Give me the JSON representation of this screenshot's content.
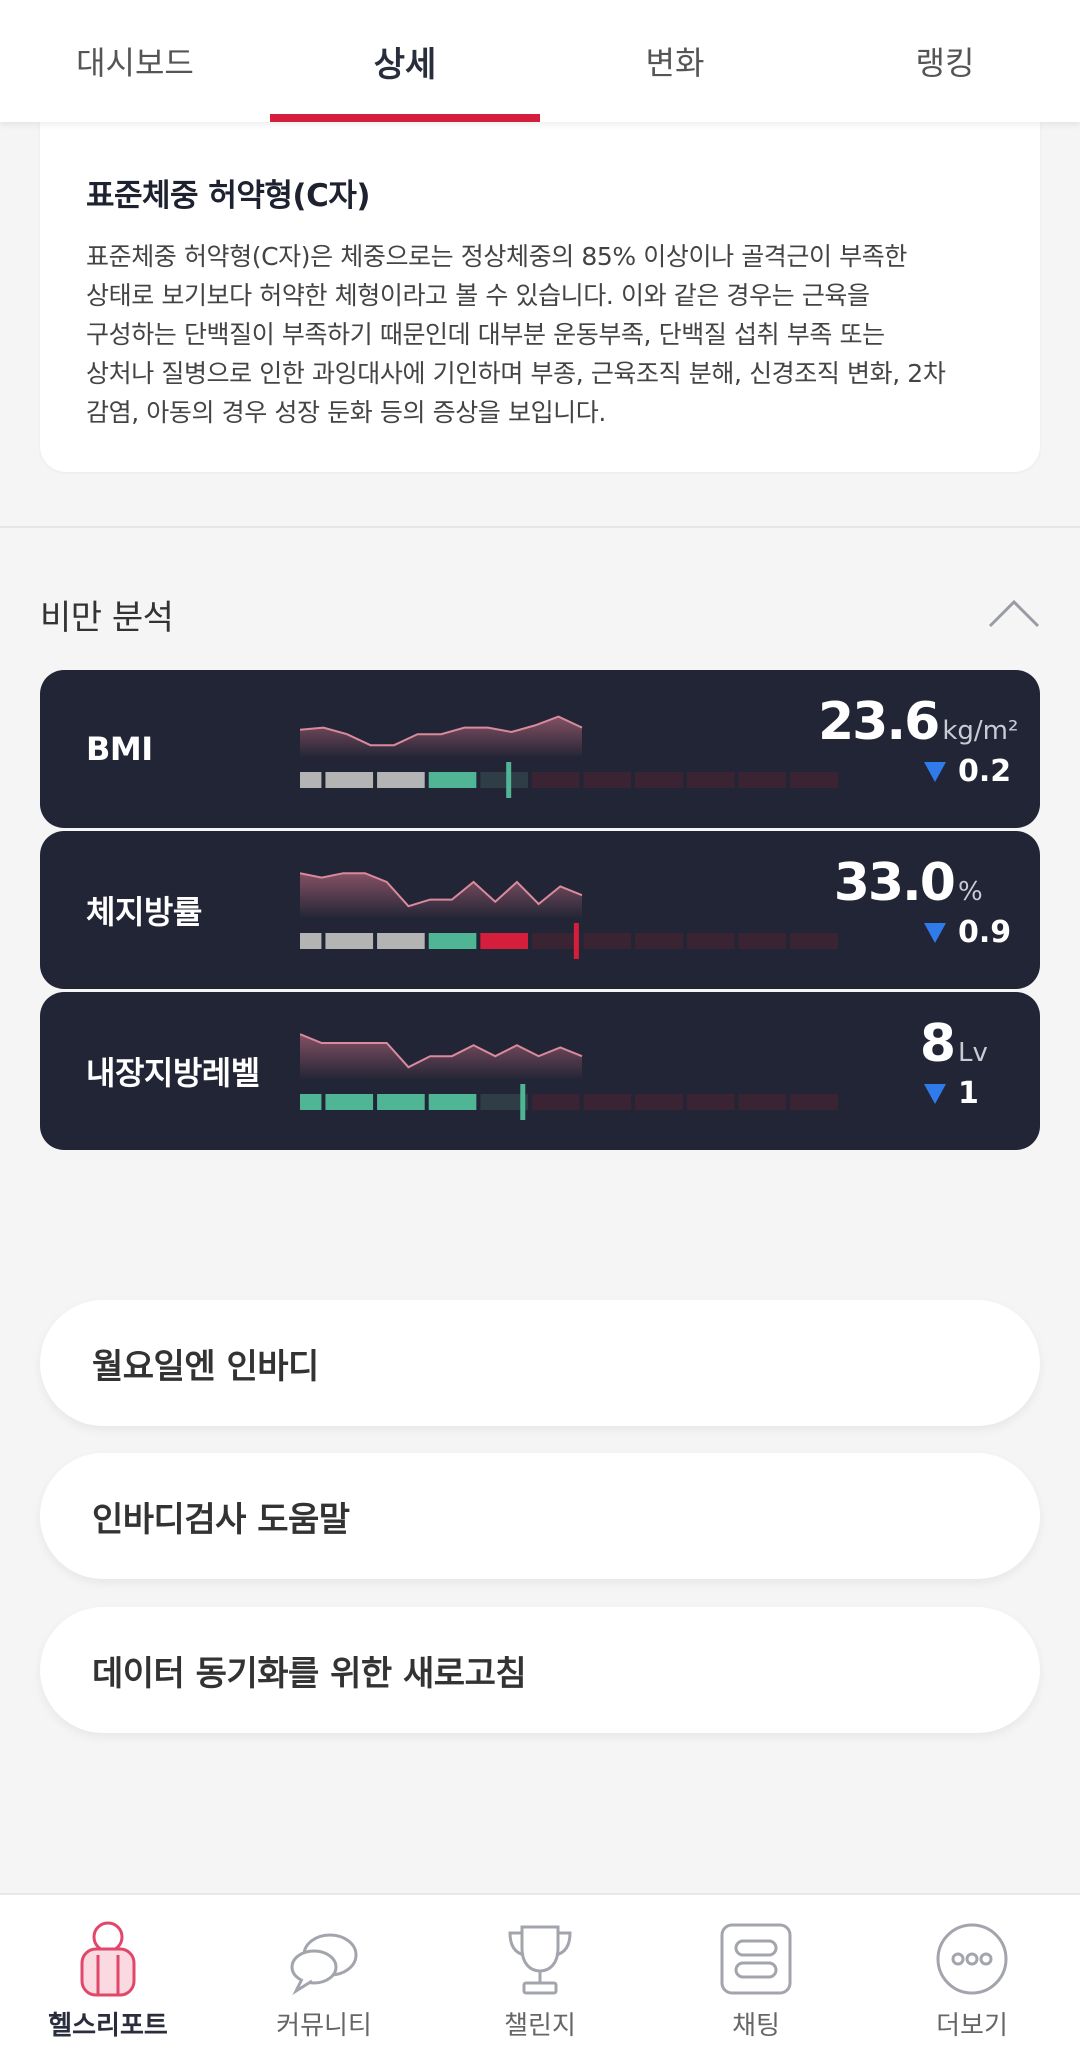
{
  "top_tabs": [
    {
      "label": "대시보드",
      "active": false
    },
    {
      "label": "상세",
      "active": true
    },
    {
      "label": "변화",
      "active": false
    },
    {
      "label": "랭킹",
      "active": false
    }
  ],
  "description": {
    "title": "표준체중 허약형(C자)",
    "lines": [
      "표준체중 허약형(C자)은 체중으로는 정상체중의 85% 이상이나 골격근이 부족한",
      "상태로 보기보다 허약한 체형이라고 볼 수 있습니다. 이와 같은 경우는 근육을",
      "구성하는 단백질이 부족하기 때문인데 대부분 운동부족, 단백질 섭취 부족 또는",
      "상처나 질병으로 인한 과잉대사에 기인하며 부종, 근육조직 분해, 신경조직 변화, 2차",
      "감염, 아동의 경우 성장 둔화 등의 증상을 보입니다."
    ]
  },
  "obesity_section": {
    "title": "비만 분석",
    "collapse_icon": "chevron-up-icon",
    "metrics": [
      {
        "label": "BMI",
        "value": "23.6",
        "unit": "kg/m²",
        "delta": "0.2",
        "delta_direction": "down",
        "filled_segments": 4,
        "gauge_position": 0.37,
        "over_color": "",
        "trend": [
          0.55,
          0.6,
          0.45,
          0.2,
          0.2,
          0.45,
          0.45,
          0.6,
          0.6,
          0.5,
          0.65,
          0.85,
          0.6
        ]
      },
      {
        "label": "체지방률",
        "value": "33.0",
        "unit": "%",
        "delta": "0.9",
        "delta_direction": "down",
        "filled_segments": 5,
        "gauge_position": 0.49,
        "over_color": "#d51d3c",
        "trend": [
          0.95,
          0.85,
          0.95,
          0.95,
          0.75,
          0.2,
          0.35,
          0.35,
          0.75,
          0.3,
          0.75,
          0.25,
          0.65,
          0.45
        ]
      },
      {
        "label": "내장지방레벨",
        "value": "8",
        "unit": "Lv",
        "delta": "1",
        "delta_direction": "down",
        "filled_segments": 4,
        "gauge_position": 0.395,
        "over_color": "",
        "trend": [
          0.95,
          0.75,
          0.75,
          0.75,
          0.75,
          0.2,
          0.45,
          0.45,
          0.7,
          0.45,
          0.7,
          0.45,
          0.65,
          0.45
        ]
      }
    ]
  },
  "list_buttons": [
    {
      "label": "월요일엔 인바디"
    },
    {
      "label": "인바디검사 도움말"
    },
    {
      "label": "데이터 동기화를 위한 새로고침"
    }
  ],
  "bottom_nav": [
    {
      "label": "헬스리포트",
      "icon": "health-report-icon",
      "active": true
    },
    {
      "label": "커뮤니티",
      "icon": "chat-bubbles-icon",
      "active": false
    },
    {
      "label": "챌린지",
      "icon": "trophy-icon",
      "active": false
    },
    {
      "label": "채팅",
      "icon": "chat-icon",
      "active": false
    },
    {
      "label": "더보기",
      "icon": "more-icon",
      "active": false
    }
  ],
  "colors": {
    "accent": "#d51d3c",
    "card_bg": "#222535",
    "normal_green": "#4fb595",
    "under_gray": "#b4b4b4",
    "delta_blue": "#2f7bea"
  }
}
